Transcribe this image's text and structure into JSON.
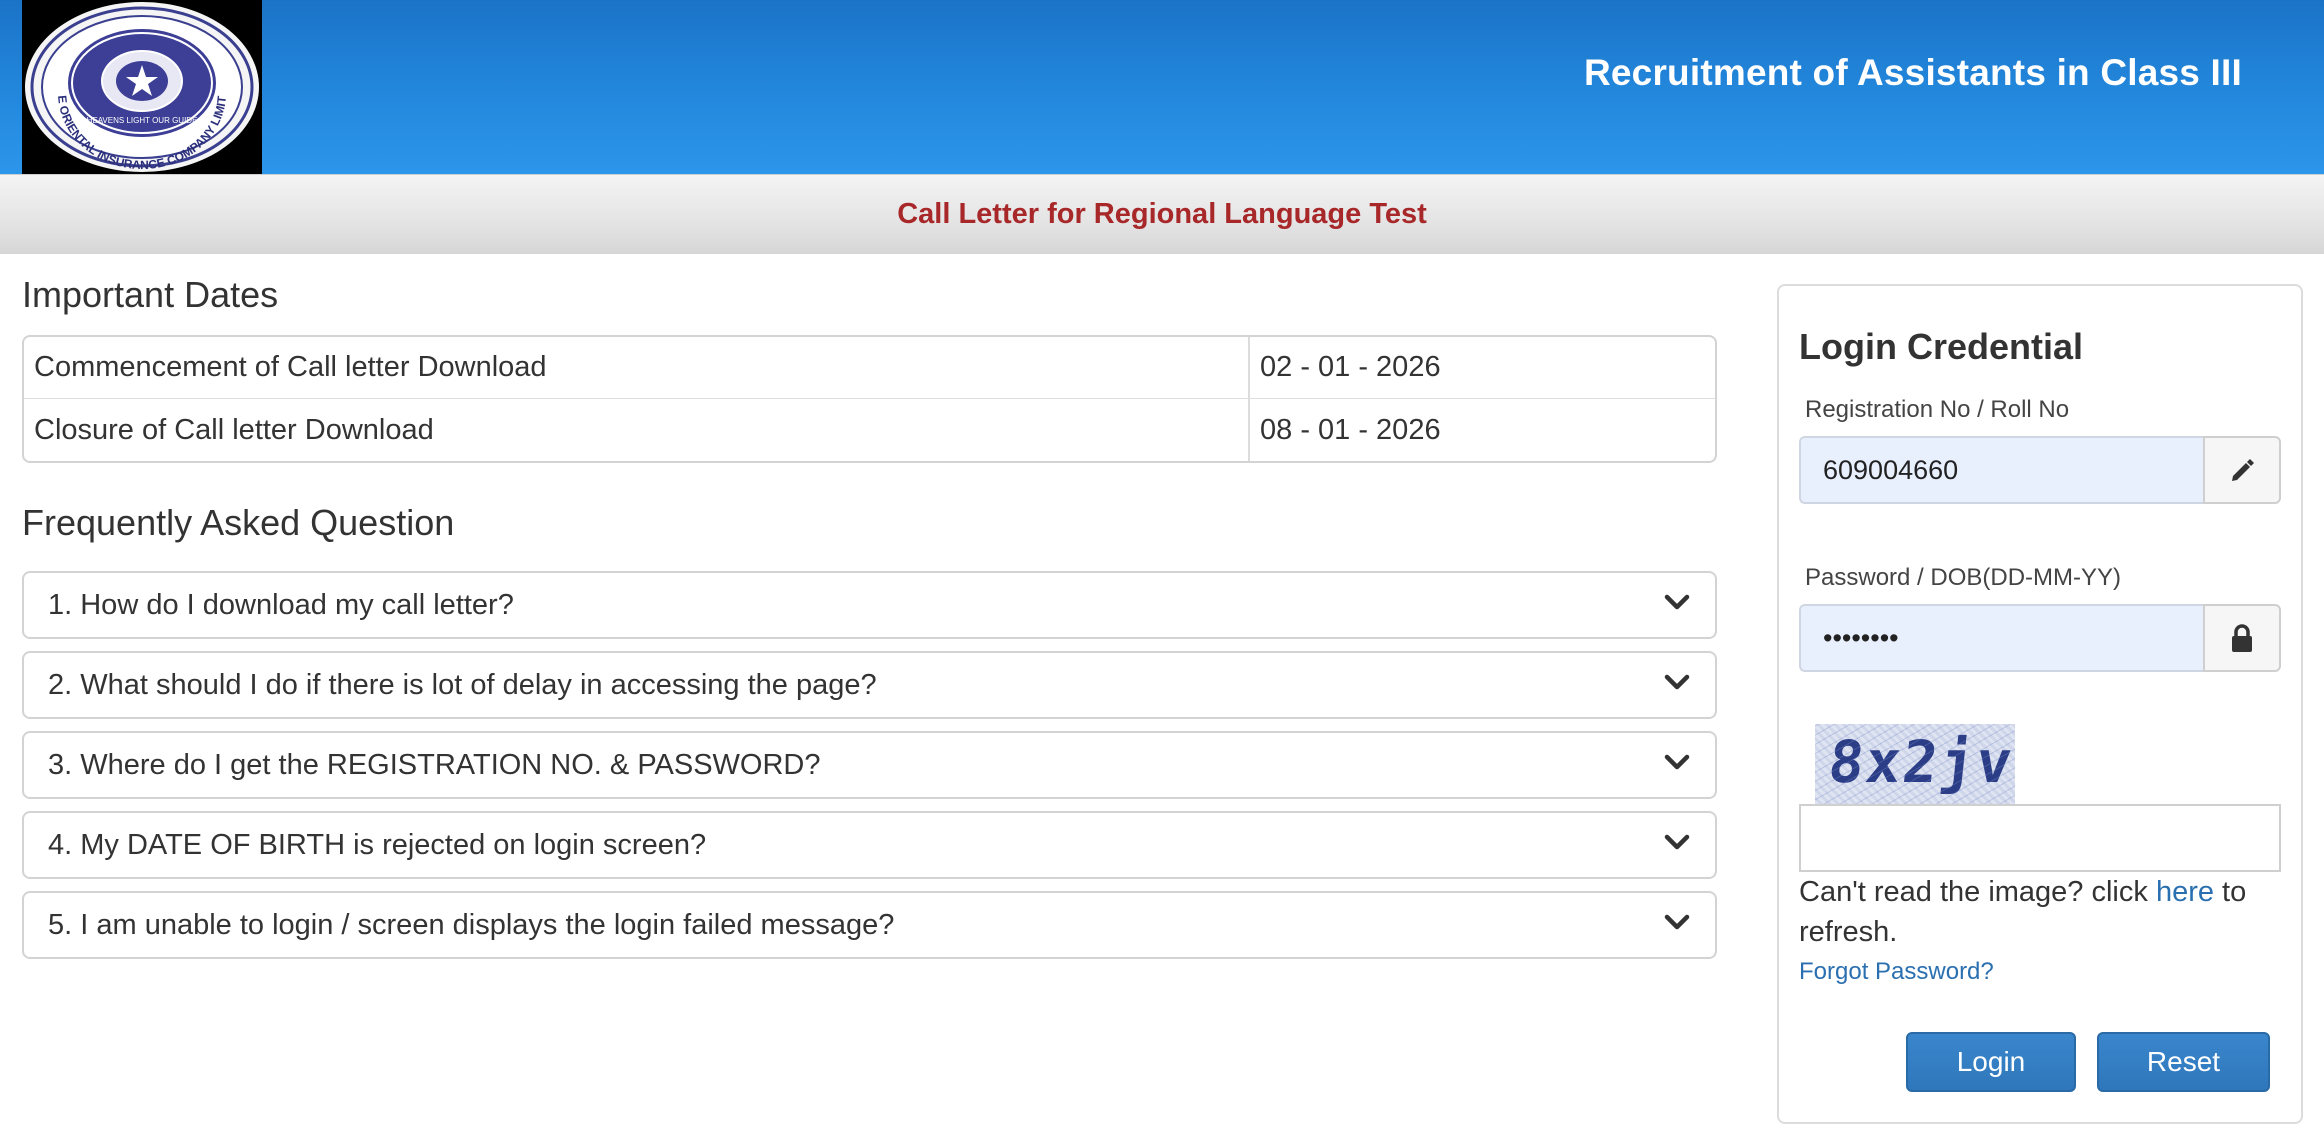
{
  "header": {
    "title": "Recruitment of Assistants in Class III",
    "logo": {
      "icon": "oriental-insurance-seal-icon",
      "outer_text": "THE ORIENTAL INSURANCE COMPANY LIMITED",
      "motto": "HEAVENS LIGHT OUR GUIDE"
    }
  },
  "subheader": {
    "title": "Call Letter for Regional Language Test"
  },
  "important_dates": {
    "heading": "Important Dates",
    "rows": [
      {
        "label": "Commencement of Call letter Download",
        "value": "02 - 01 - 2026"
      },
      {
        "label": "Closure of Call letter Download",
        "value": "08 - 01 - 2026"
      }
    ]
  },
  "faq": {
    "heading": "Frequently Asked Question",
    "items": [
      {
        "question": "1. How do I download my call letter?"
      },
      {
        "question": "2. What should I do if there is lot of delay in accessing the page?"
      },
      {
        "question": "3. Where do I get the REGISTRATION NO. & PASSWORD?"
      },
      {
        "question": "4. My DATE OF BIRTH is rejected on login screen?"
      },
      {
        "question": "5. I am unable to login / screen displays the login failed message?"
      }
    ],
    "expand_icon": "chevron-down-icon"
  },
  "login": {
    "title": "Login Credential",
    "registration": {
      "label": "Registration No / Roll No",
      "value": "609004660",
      "icon": "pencil-icon"
    },
    "password": {
      "label": "Password / DOB(DD-MM-YY)",
      "value": "••••••••",
      "icon": "lock-icon"
    },
    "captcha": {
      "text": "8x2jv",
      "input_value": ""
    },
    "refresh_prefix": "Can't read the image? click ",
    "refresh_link": "here",
    "refresh_suffix": " to refresh.",
    "forgot_password": "Forgot Password?",
    "login_button": "Login",
    "reset_button": "Reset"
  },
  "colors": {
    "header_blue": "#2388dd",
    "subheader_red": "#a8282a",
    "link_blue": "#2a6fb0",
    "button_blue": "#2f77bb",
    "input_fill": "#e8f0fe"
  }
}
